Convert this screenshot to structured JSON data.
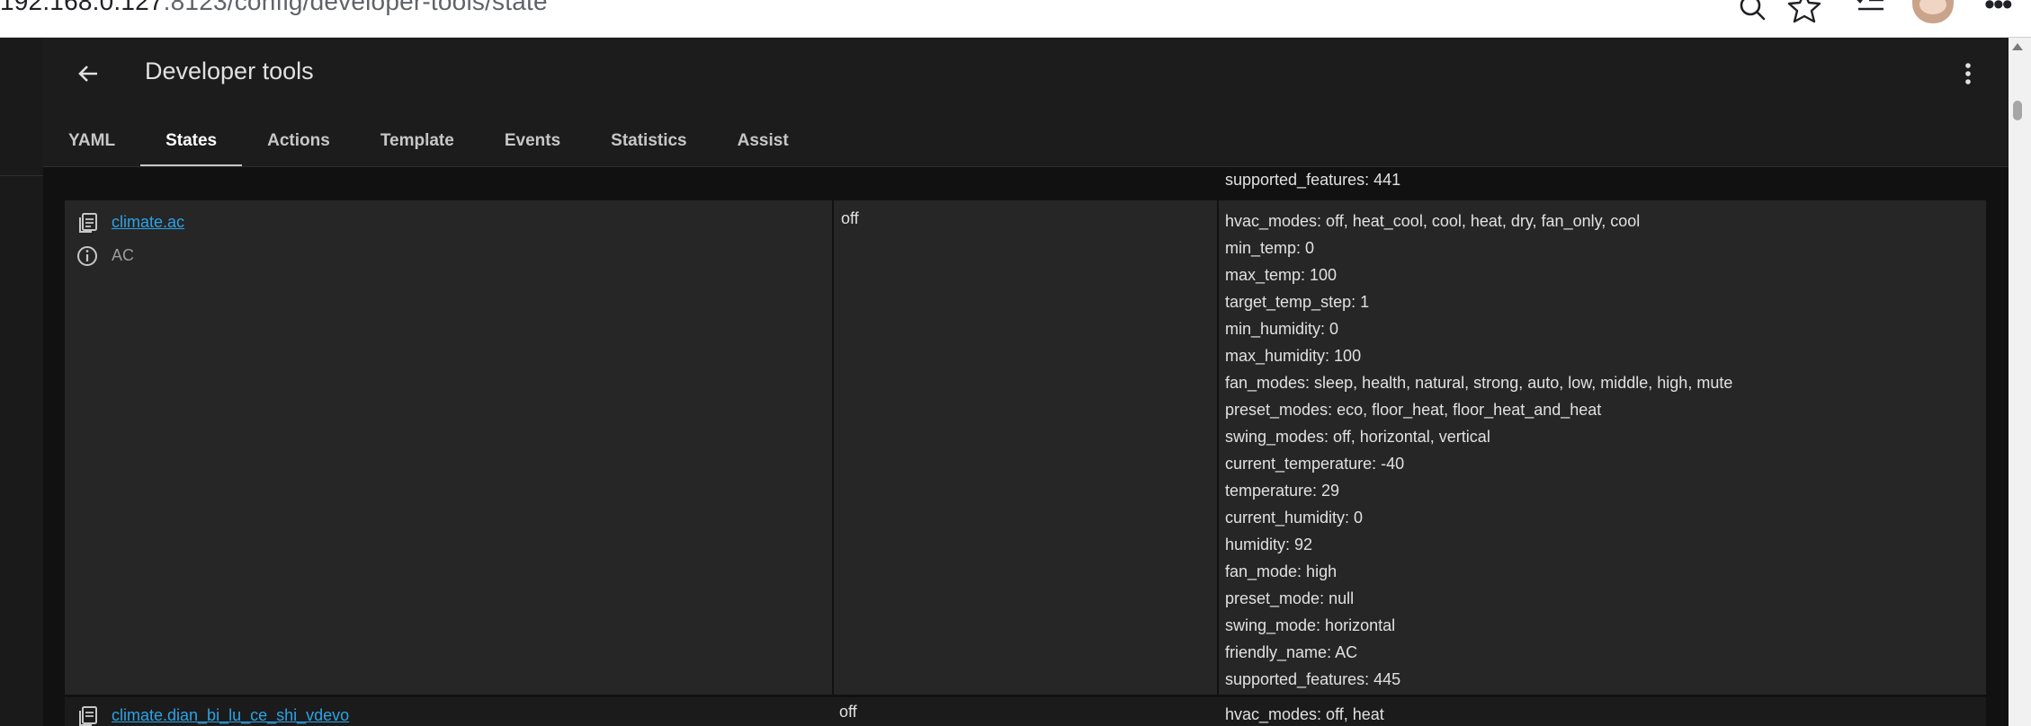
{
  "browser": {
    "url_host": "192.168.0.127",
    "url_path": ":8123/config/developer-tools/state",
    "icons": [
      "search-icon",
      "star-icon",
      "reading-list-icon",
      "avatar",
      "more-icon"
    ]
  },
  "header": {
    "title": "Developer tools",
    "back_icon": "arrow-left-icon",
    "menu_icon": "dots-vertical-icon"
  },
  "tabs": [
    {
      "label": "YAML",
      "active": false
    },
    {
      "label": "States",
      "active": true
    },
    {
      "label": "Actions",
      "active": false
    },
    {
      "label": "Template",
      "active": false
    },
    {
      "label": "Events",
      "active": false
    },
    {
      "label": "Statistics",
      "active": false
    },
    {
      "label": "Assist",
      "active": false
    }
  ],
  "previous_row_tail": "supported_features: 441",
  "rows": [
    {
      "entity_id": "climate.ac",
      "friendly_name": "AC",
      "state": "off",
      "attributes": [
        "hvac_modes: off, heat_cool, cool, heat, dry, fan_only, cool",
        "min_temp: 0",
        "max_temp: 100",
        "target_temp_step: 1",
        "min_humidity: 0",
        "max_humidity: 100",
        "fan_modes: sleep, health, natural, strong, auto, low, middle, high, mute",
        "preset_modes: eco, floor_heat, floor_heat_and_heat",
        "swing_modes: off, horizontal, vertical",
        "current_temperature: -40",
        "temperature: 29",
        "current_humidity: 0",
        "humidity: 92",
        "fan_mode: high",
        "preset_mode: null",
        "swing_mode: horizontal",
        "friendly_name: AC",
        "supported_features: 445"
      ]
    },
    {
      "entity_id": "climate.dian_bi_lu_ce_shi_vdevo",
      "state": "off",
      "attributes": [
        "hvac_modes: off, heat"
      ]
    }
  ],
  "colors": {
    "background": "#111111",
    "row_bg": "#262626",
    "link": "#2ea2e6",
    "text": "#e1e1e1"
  }
}
